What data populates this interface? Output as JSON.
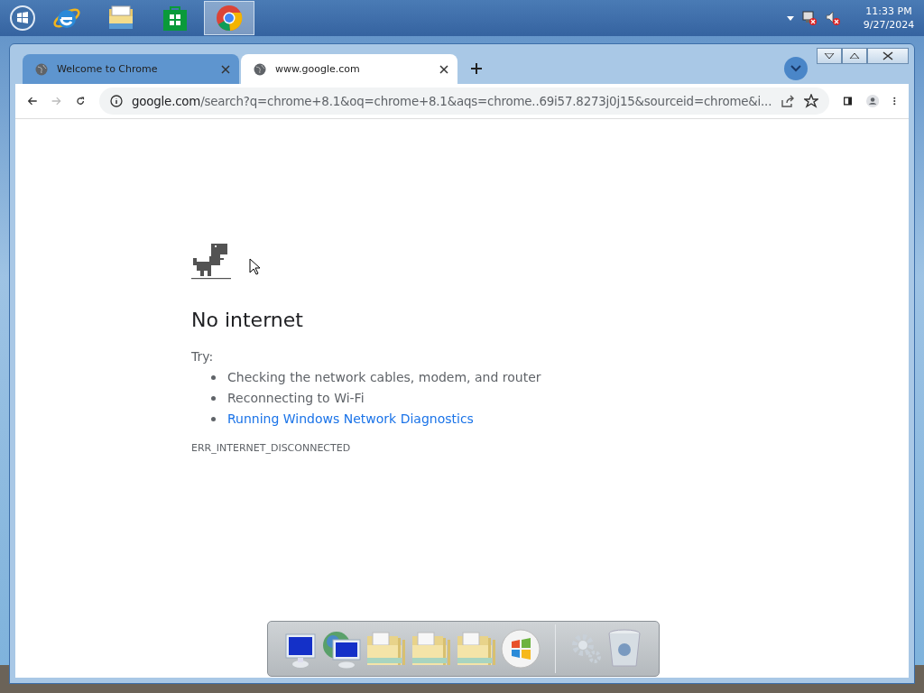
{
  "taskbar": {
    "apps": [
      {
        "kind": "ie",
        "selected": false
      },
      {
        "kind": "explorer",
        "selected": false
      },
      {
        "kind": "store",
        "selected": false
      },
      {
        "kind": "chrome",
        "selected": true
      }
    ],
    "clock": {
      "time": "11:33 PM",
      "date": "9/27/2024"
    }
  },
  "browser": {
    "tabs": [
      {
        "title": "Welcome to Chrome",
        "selected": false
      },
      {
        "title": "www.google.com",
        "selected": true
      }
    ],
    "address": {
      "host": "google.com",
      "path": "/search?q=chrome+8.1&oq=chrome+8.1&aqs=chrome..69i57.8273j0j15&sourceid=chrome&i..."
    }
  },
  "page": {
    "title": "No internet",
    "try_label": "Try:",
    "suggestions": [
      {
        "text": "Checking the network cables, modem, and router",
        "kind": "text"
      },
      {
        "text": "Reconnecting to Wi-Fi",
        "kind": "text"
      },
      {
        "text": "Running Windows Network Diagnostics",
        "kind": "link"
      }
    ],
    "error_code": "ERR_INTERNET_DISCONNECTED"
  },
  "dock": {
    "items": [
      {
        "kind": "computer"
      },
      {
        "kind": "network"
      },
      {
        "kind": "folder"
      },
      {
        "kind": "folder"
      },
      {
        "kind": "folder"
      },
      {
        "kind": "orb"
      },
      {
        "kind": "gears"
      },
      {
        "kind": "bin"
      }
    ]
  }
}
